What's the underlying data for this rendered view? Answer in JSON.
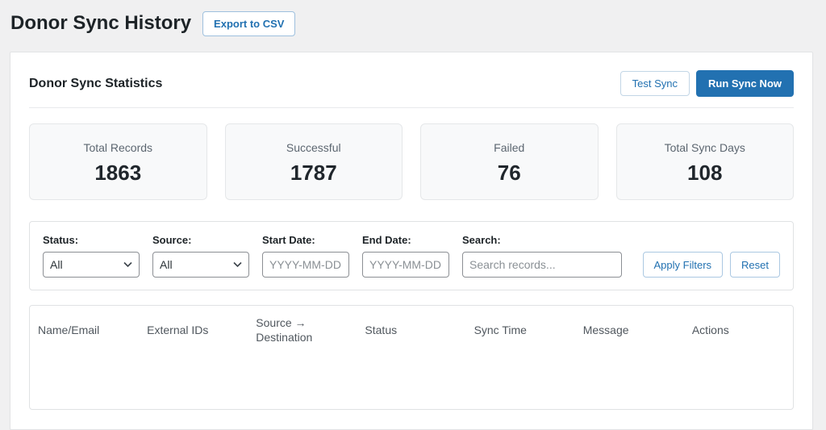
{
  "page": {
    "title": "Donor Sync History",
    "export_button": "Export to CSV"
  },
  "stats_card": {
    "heading": "Donor Sync Statistics",
    "test_sync_button": "Test Sync",
    "run_sync_button": "Run Sync Now"
  },
  "stats": [
    {
      "label": "Total Records",
      "value": "1863"
    },
    {
      "label": "Successful",
      "value": "1787"
    },
    {
      "label": "Failed",
      "value": "76"
    },
    {
      "label": "Total Sync Days",
      "value": "108"
    }
  ],
  "filters": {
    "status": {
      "label": "Status:",
      "value": "All"
    },
    "source": {
      "label": "Source:",
      "value": "All"
    },
    "start_date": {
      "label": "Start Date:",
      "placeholder": "YYYY-MM-DD"
    },
    "end_date": {
      "label": "End Date:",
      "placeholder": "YYYY-MM-DD"
    },
    "search": {
      "label": "Search:",
      "placeholder": "Search records..."
    },
    "apply_button": "Apply Filters",
    "reset_button": "Reset"
  },
  "table": {
    "headers": [
      "Name/Email",
      "External IDs",
      "Source → Destination",
      "Status",
      "Sync Time",
      "Message",
      "Actions"
    ]
  },
  "colors": {
    "accent": "#2271b1",
    "page_background": "#f0f0f1",
    "card_background": "#ffffff",
    "stat_box_background": "#f8f9fa"
  }
}
